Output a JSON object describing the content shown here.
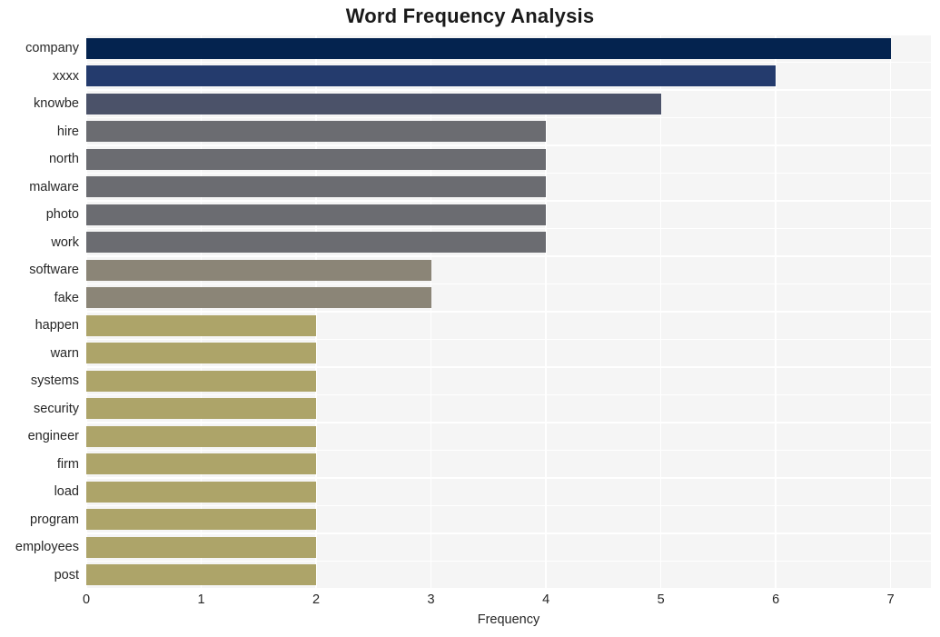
{
  "chart_data": {
    "type": "bar",
    "orientation": "horizontal",
    "title": "Word Frequency Analysis",
    "xlabel": "Frequency",
    "ylabel": "",
    "xlim": [
      0,
      7.35
    ],
    "xticks": [
      0,
      1,
      2,
      3,
      4,
      5,
      6,
      7
    ],
    "xtick_labels": [
      "0",
      "1",
      "2",
      "3",
      "4",
      "5",
      "6",
      "7"
    ],
    "grid": true,
    "legend": false,
    "categories": [
      "company",
      "xxxx",
      "knowbe",
      "hire",
      "north",
      "malware",
      "photo",
      "work",
      "software",
      "fake",
      "happen",
      "warn",
      "systems",
      "security",
      "engineer",
      "firm",
      "load",
      "program",
      "employees",
      "post"
    ],
    "values": [
      7,
      6,
      5,
      4,
      4,
      4,
      4,
      4,
      3,
      3,
      2,
      2,
      2,
      2,
      2,
      2,
      2,
      2,
      2,
      2
    ],
    "bar_colors": [
      "#04234f",
      "#243b6d",
      "#4b5269",
      "#6b6c71",
      "#6b6c71",
      "#6b6c71",
      "#6b6c71",
      "#6b6c71",
      "#8b8577",
      "#8b8577",
      "#ada469",
      "#ada469",
      "#ada469",
      "#ada469",
      "#ada469",
      "#ada469",
      "#ada469",
      "#ada469",
      "#ada469",
      "#ada469"
    ]
  },
  "style": {
    "plot_background": "#f5f5f5",
    "figure_background": "#ffffff",
    "grid_color": "#ffffff",
    "text_color": "#262626"
  }
}
